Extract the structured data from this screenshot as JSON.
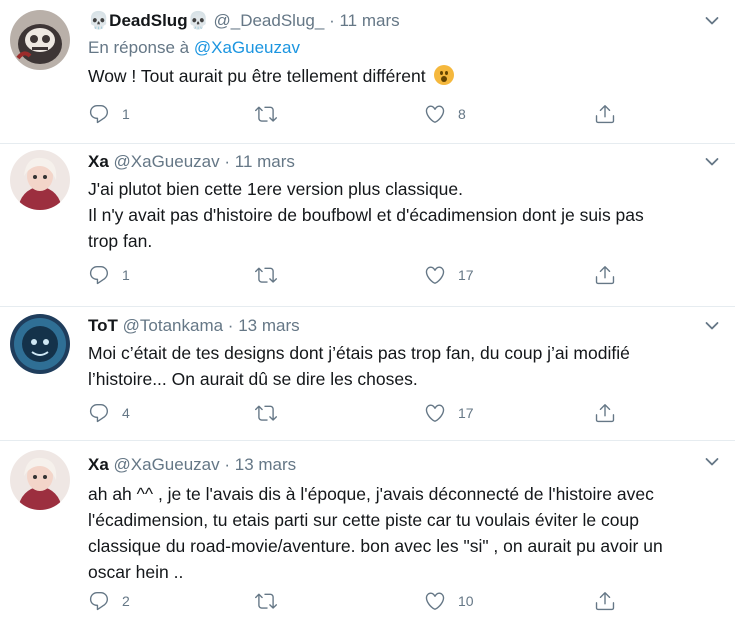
{
  "tweets": [
    {
      "name": "DeadSlug",
      "name_prefix_icon": "💀",
      "name_suffix_icon": "💀",
      "handle": "@_DeadSlug_",
      "separator": "·",
      "date": "11 mars",
      "reply_prefix": "En réponse à",
      "reply_to": "@XaGueuzav",
      "text_lines": [
        "Wow ! Tout aurait pu être tellement différent"
      ],
      "emoji": "hushed-face-emoji",
      "replies": "1",
      "retweets": "",
      "likes": "8"
    },
    {
      "name": "Xa",
      "handle": "@XaGueuzav",
      "separator": "·",
      "date": "11 mars",
      "text_lines": [
        "J'ai plutot bien cette 1ere version plus classique.",
        "Il n'y avait pas d'histoire de boufbowl et d'écadimension dont je suis pas",
        "trop fan."
      ],
      "replies": "1",
      "retweets": "",
      "likes": "17"
    },
    {
      "name": "ToT",
      "handle": "@Totankama",
      "separator": "·",
      "date": "13 mars",
      "text_lines": [
        "Moi c’était de tes designs dont j’étais pas trop fan, du coup j’ai modifié",
        "l’histoire... On aurait dû se dire les choses."
      ],
      "replies": "4",
      "retweets": "",
      "likes": "17"
    },
    {
      "name": "Xa",
      "handle": "@XaGueuzav",
      "separator": "·",
      "date": "13 mars",
      "text_lines": [
        "ah ah ^^ , je te l'avais dis à l'époque, j'avais déconnecté de l'histoire avec",
        "l'écadimension, tu etais parti sur cette piste car tu voulais éviter le coup",
        "classique du road-movie/aventure. bon avec les \"si\" , on aurait pu avoir un",
        "oscar hein .."
      ],
      "replies": "2",
      "retweets": "",
      "likes": "10"
    }
  ],
  "icons": {
    "reply": "reply-icon",
    "retweet": "retweet-icon",
    "like": "heart-icon",
    "share": "share-icon",
    "menu": "chevron-down-icon"
  },
  "colors": {
    "text": "#14171a",
    "secondary": "#657786",
    "link": "#1b95e0",
    "divider": "#e6ecf0"
  }
}
